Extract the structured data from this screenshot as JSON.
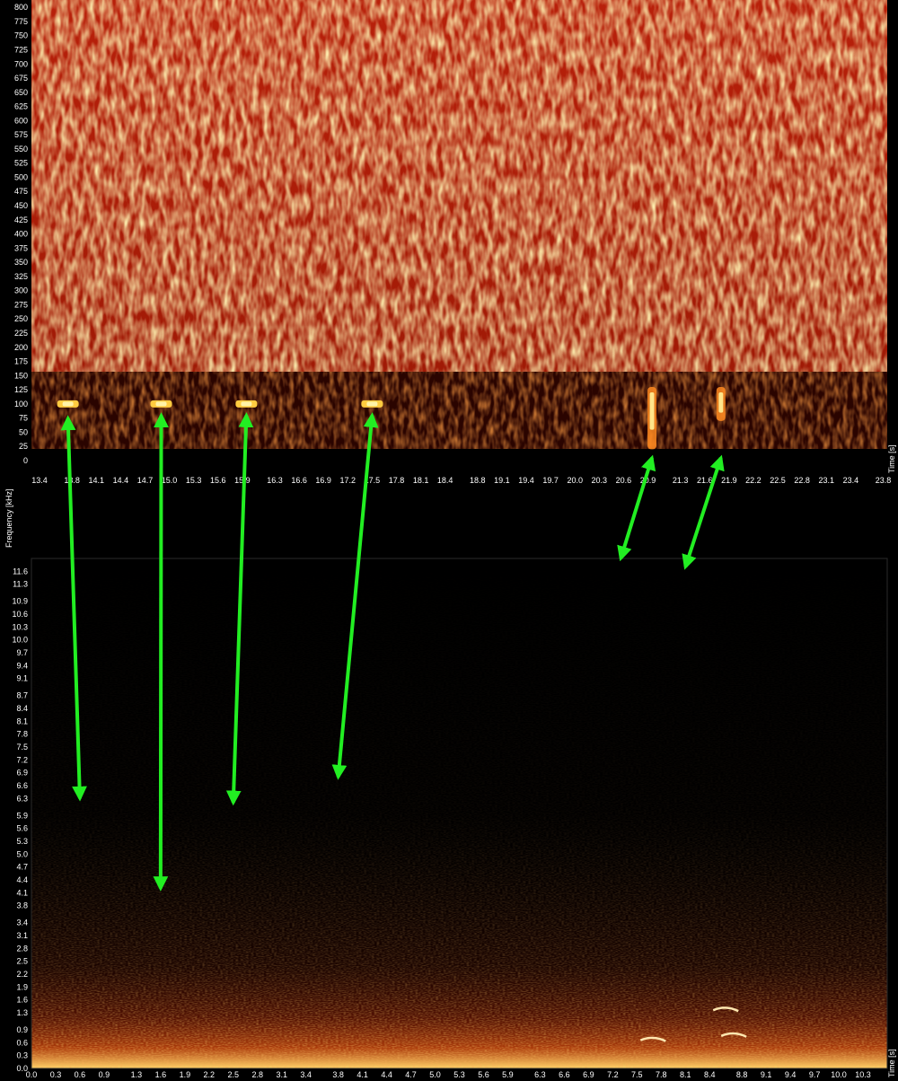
{
  "chart_data": [
    {
      "type": "heatmap",
      "panel": "top",
      "colormap": "heat",
      "x_ticks": [
        "13.4",
        "13.8",
        "14.1",
        "14.4",
        "14.7",
        "15.0",
        "15.3",
        "15.6",
        "15.9",
        "16.3",
        "16.6",
        "16.9",
        "17.2",
        "17.5",
        "17.8",
        "18.1",
        "18.4",
        "18.8",
        "19.1",
        "19.4",
        "19.7",
        "20.0",
        "20.3",
        "20.6",
        "20.9",
        "21.3",
        "21.6",
        "21.9",
        "22.2",
        "22.5",
        "22.8",
        "23.1",
        "23.4",
        "23.8"
      ],
      "y_ticks": [
        "0",
        "25",
        "50",
        "75",
        "100",
        "125",
        "150",
        "175",
        "200",
        "225",
        "250",
        "275",
        "300",
        "325",
        "350",
        "375",
        "400",
        "425",
        "450",
        "475",
        "500",
        "525",
        "550",
        "575",
        "600",
        "625",
        "650",
        "675",
        "700",
        "725",
        "750",
        "775",
        "800"
      ],
      "xlabel": "Time [s]",
      "xlim": [
        13.3,
        23.85
      ],
      "ylim": [
        0,
        805
      ],
      "bands": [
        {
          "name": "noise",
          "from": 175,
          "to": 805,
          "level": 0.75
        },
        {
          "name": "low",
          "from": 45,
          "to": 175,
          "level": 0.3
        }
      ],
      "call_features": [
        {
          "t": 13.75,
          "f": 100
        },
        {
          "t": 14.9,
          "f": 100
        },
        {
          "t": 15.95,
          "f": 100
        },
        {
          "t": 17.5,
          "f": 100
        },
        {
          "t": 20.95,
          "f_from": 20,
          "f_to": 130
        },
        {
          "t": 21.8,
          "f_from": 70,
          "f_to": 130
        }
      ]
    },
    {
      "type": "heatmap",
      "panel": "bottom",
      "colormap": "heat",
      "x_ticks": [
        "0.0",
        "0.3",
        "0.6",
        "0.9",
        "1.3",
        "1.6",
        "1.9",
        "2.2",
        "2.5",
        "2.8",
        "3.1",
        "3.4",
        "3.8",
        "4.1",
        "4.4",
        "4.7",
        "5.0",
        "5.3",
        "5.6",
        "5.9",
        "6.3",
        "6.6",
        "6.9",
        "7.2",
        "7.5",
        "7.8",
        "8.1",
        "8.4",
        "8.8",
        "9.1",
        "9.4",
        "9.7",
        "10.0",
        "10.3"
      ],
      "y_ticks": [
        "0.0",
        "0.3",
        "0.6",
        "0.9",
        "1.3",
        "1.6",
        "1.9",
        "2.2",
        "2.5",
        "2.8",
        "3.1",
        "3.4",
        "3.8",
        "4.1",
        "4.4",
        "4.7",
        "5.0",
        "5.3",
        "5.6",
        "5.9",
        "6.3",
        "6.6",
        "6.9",
        "7.2",
        "7.5",
        "7.8",
        "8.1",
        "8.4",
        "8.7",
        "9.1",
        "9.4",
        "9.7",
        "10.0",
        "10.3",
        "10.6",
        "10.9",
        "11.3",
        "11.6"
      ],
      "xlabel": "Time [s]",
      "xlim": [
        0,
        10.6
      ],
      "ylim": [
        0,
        11.9
      ],
      "call_features": [
        {
          "t": 7.7,
          "f": 0.7
        },
        {
          "t": 8.6,
          "f": 1.4
        },
        {
          "t": 8.7,
          "f": 0.8
        }
      ]
    }
  ],
  "ylabel": "Frequency [kHz]",
  "annotations": {
    "arrow_color": "#22ee22",
    "arrows": [
      {
        "from_panel": "top",
        "t_top": 13.75,
        "f_top": 75,
        "to_panel": "bottom",
        "t_bottom": 0.6,
        "f_bottom": 6.3
      },
      {
        "from_panel": "top",
        "t_top": 14.9,
        "f_top": 80,
        "to_panel": "bottom",
        "t_bottom": 1.6,
        "f_bottom": 4.2
      },
      {
        "from_panel": "top",
        "t_top": 15.95,
        "f_top": 80,
        "to_panel": "bottom",
        "t_bottom": 2.5,
        "f_bottom": 6.2
      },
      {
        "from_panel": "top",
        "t_top": 17.5,
        "f_top": 80,
        "to_panel": "bottom",
        "t_bottom": 3.8,
        "f_bottom": 6.8
      },
      {
        "from_panel": "top",
        "t_top": 20.95,
        "f_top": 5,
        "to_panel": "bottom",
        "t_bottom": 7.3,
        "f_bottom": 11.9
      },
      {
        "from_panel": "top",
        "t_top": 21.8,
        "f_top": 5,
        "to_panel": "bottom",
        "t_bottom": 8.1,
        "f_bottom": 11.7
      }
    ]
  }
}
